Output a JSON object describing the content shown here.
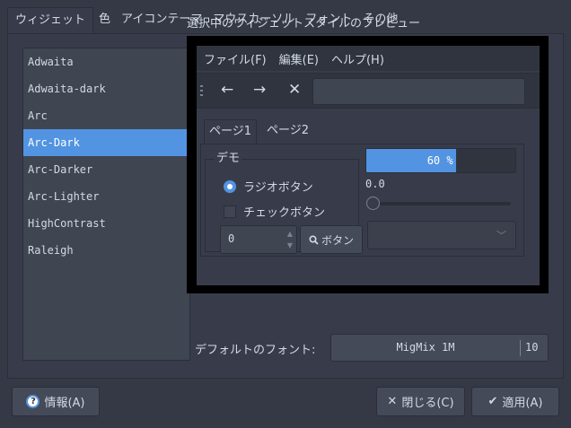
{
  "tabs": [
    {
      "label": "ウィジェット",
      "active": true
    },
    {
      "label": "色"
    },
    {
      "label": "アイコンテーマ"
    },
    {
      "label": "マウスカーソル"
    },
    {
      "label": "フォント"
    },
    {
      "label": "その他"
    }
  ],
  "themes": {
    "items": [
      "Adwaita",
      "Adwaita-dark",
      "Arc",
      "Arc-Dark",
      "Arc-Darker",
      "Arc-Lighter",
      "HighContrast",
      "Raleigh"
    ],
    "selected": "Arc-Dark"
  },
  "preview": {
    "title": "選択中のウィジェットスタイルのプレビュー",
    "menu": [
      "ファイル(F)",
      "編集(E)",
      "ヘルプ(H)"
    ],
    "toolbar": {
      "back": "←",
      "forward": "→",
      "stop": "✕"
    },
    "page_tabs": [
      "ページ1",
      "ページ2"
    ],
    "demo_label": "デモ",
    "radio_label": "ラジオボタン",
    "check_label": "チェックボタン",
    "spin_value": "0",
    "button_label": "ボタン",
    "progress": {
      "value": 60,
      "text": "60 %"
    },
    "slider": {
      "value_text": "0.0",
      "value": 0
    }
  },
  "font": {
    "label": "デフォルトのフォント:",
    "name": "MigMix 1M",
    "size": "10"
  },
  "buttons": {
    "info": "情報(A)",
    "close": "閉じる(C)",
    "apply": "適用(A)"
  },
  "colors": {
    "accent": "#5294e2",
    "background": "#383c4a",
    "base": "#404552"
  }
}
